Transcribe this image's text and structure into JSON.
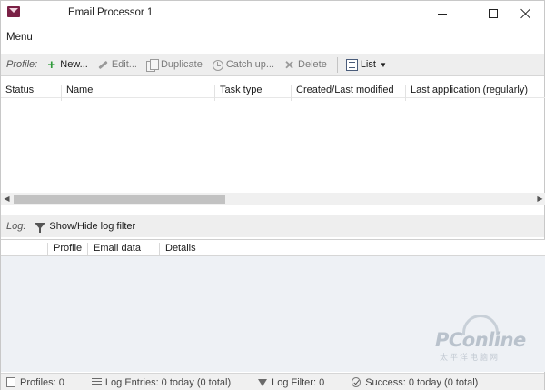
{
  "window": {
    "title": "Email Processor 1"
  },
  "menu": {
    "label": "Menu"
  },
  "toolbar": {
    "profile_label": "Profile:",
    "new": "New...",
    "edit": "Edit...",
    "duplicate": "Duplicate",
    "catch_up": "Catch up...",
    "delete": "Delete",
    "view": "List"
  },
  "profiles_table": {
    "columns": [
      "Status",
      "Name",
      "Task type",
      "Created/Last modified",
      "Last application (regularly)"
    ]
  },
  "log": {
    "label": "Log:",
    "filter_toggle": "Show/Hide log filter",
    "columns": [
      "Profile",
      "Email data",
      "Details"
    ]
  },
  "statusbar": {
    "profiles": "Profiles: 0",
    "log_entries": "Log Entries: 0 today (0 total)",
    "log_filter": "Log Filter: 0",
    "success": "Success: 0 today (0 total)"
  },
  "watermark": {
    "brand": "PConline",
    "subtitle": "太平洋电脑网"
  }
}
